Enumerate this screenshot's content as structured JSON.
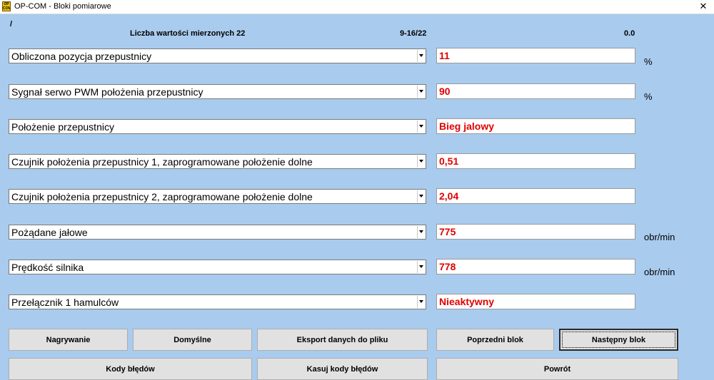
{
  "window": {
    "icon_text": "OP COM",
    "title": "OP-COM - Bloki pomiarowe",
    "close_glyph": "✕"
  },
  "header": {
    "slash": "/",
    "values_count": "Liczba wartości mierzonych 22",
    "block_range": "9-16/22",
    "time": "0.0"
  },
  "rows": [
    {
      "label": "Obliczona pozycja przepustnicy",
      "value": "11",
      "unit": "%"
    },
    {
      "label": "Sygnał serwo PWM położenia przepustnicy",
      "value": "90",
      "unit": "%"
    },
    {
      "label": "Położenie przepustnicy",
      "value": "Bieg jalowy",
      "unit": ""
    },
    {
      "label": "Czujnik położenia przepustnicy 1, zaprogramowane położenie dolne",
      "value": "0,51",
      "unit": ""
    },
    {
      "label": "Czujnik położenia przepustnicy 2, zaprogramowane położenie dolne",
      "value": "2,04",
      "unit": ""
    },
    {
      "label": "Pożądane jałowe",
      "value": "775",
      "unit": "obr/min"
    },
    {
      "label": "Prędkość silnika",
      "value": "778",
      "unit": "obr/min"
    },
    {
      "label": "Przełącznik 1 hamulców",
      "value": "Nieaktywny",
      "unit": ""
    }
  ],
  "buttons": {
    "record": "Nagrywanie",
    "defaults": "Domyślne",
    "export": "Eksport danych do pliku",
    "prev_block": "Poprzedni blok",
    "next_block": "Następny blok",
    "error_codes": "Kody błędów",
    "clear_codes": "Kasuj kody błędów",
    "back": "Powrót"
  },
  "icons": {
    "app": "opcom-logo-icon",
    "close": "close-icon",
    "dropdown": "chevron-down-icon"
  },
  "colors": {
    "background": "#a9cbee",
    "value_text": "#e00000"
  }
}
